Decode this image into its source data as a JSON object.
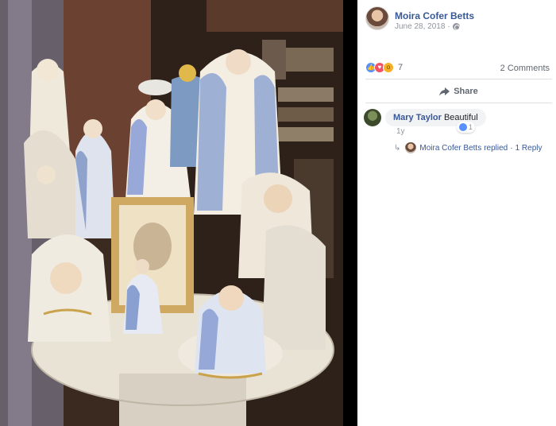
{
  "post": {
    "author": "Moira Cofer Betts",
    "date": "June 28, 2018",
    "dot": "·",
    "privacy_icon": "globe-icon"
  },
  "reactions": {
    "icons": [
      "like-icon",
      "love-icon",
      "wow-icon"
    ],
    "count": "7",
    "comments": "2 Comments"
  },
  "actions": {
    "share_label": "Share"
  },
  "comment": {
    "name": "Mary Taylor",
    "text": "Beautiful",
    "reaction_count": "1",
    "time": "1y"
  },
  "reply": {
    "author": "Moira Cofer Betts",
    "action": "replied",
    "sep": "·",
    "count": "1 Reply"
  },
  "colors": {
    "link": "#385898",
    "muted": "#90949c",
    "like": "#5890ff",
    "love": "#f25268",
    "wow": "#f7b125"
  }
}
